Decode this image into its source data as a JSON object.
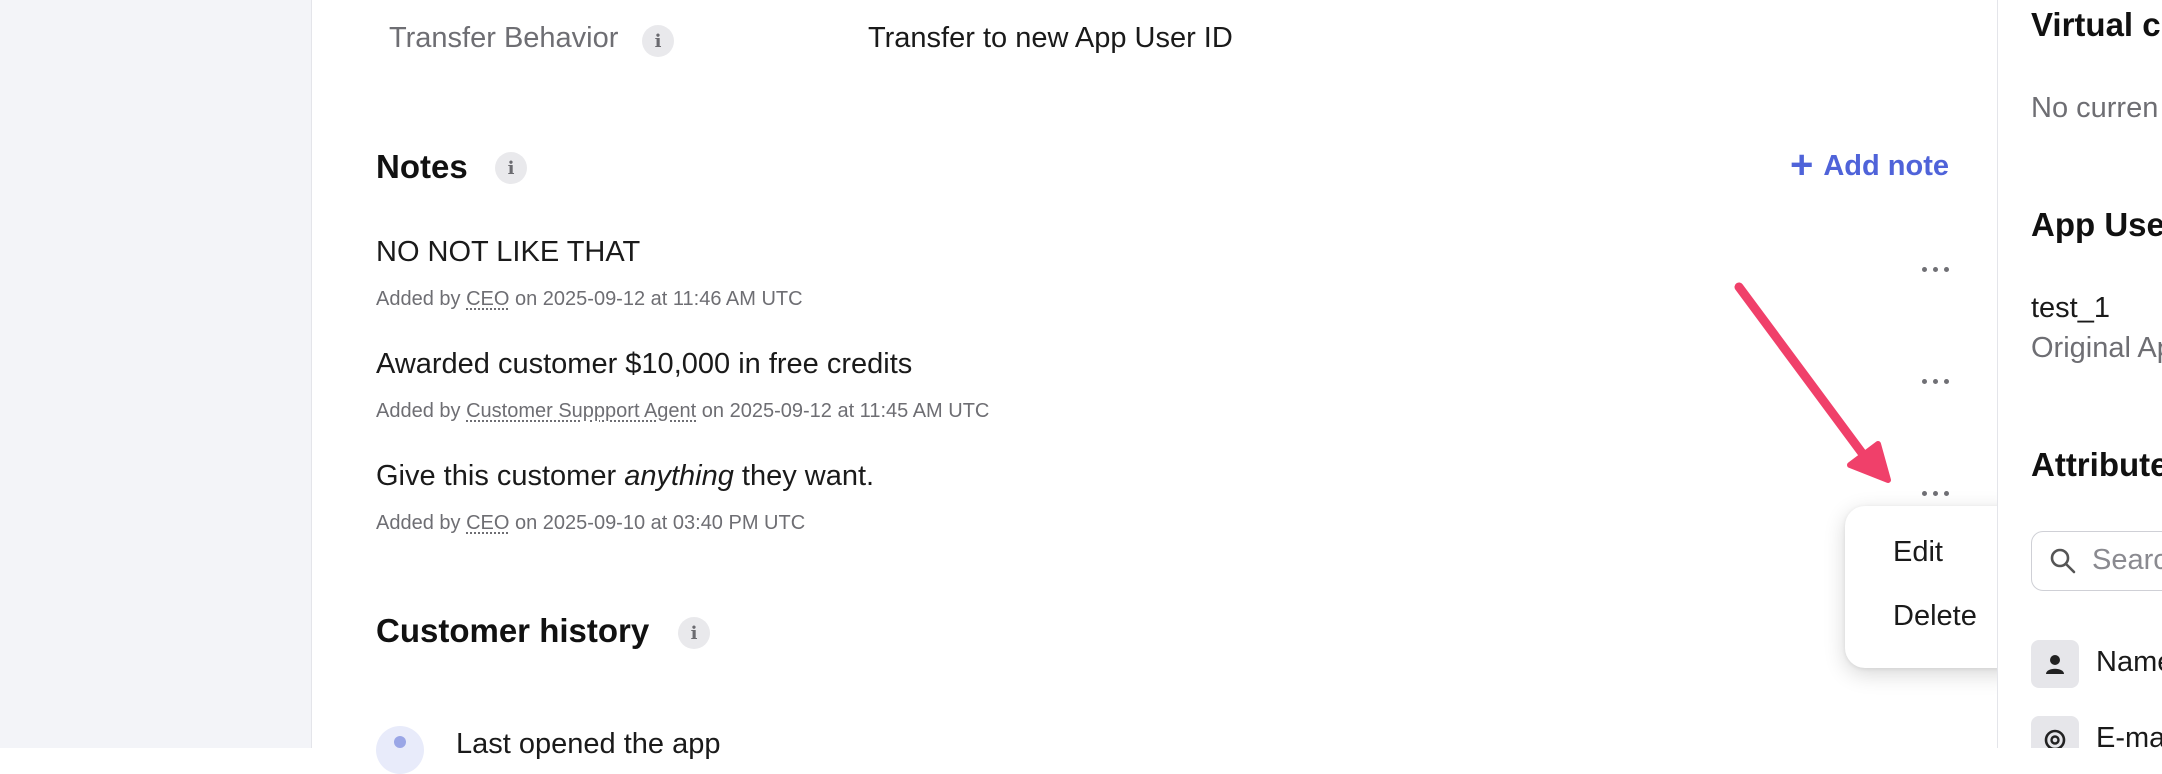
{
  "transfer": {
    "label": "Transfer Behavior",
    "value": "Transfer to new App User ID"
  },
  "notes": {
    "title": "Notes",
    "add_label": "Add note",
    "items": [
      {
        "text": "NO NOT LIKE THAT",
        "meta_prefix": "Added by",
        "author": "CEO",
        "meta_suffix": "on 2025-09-12 at 11:46 AM UTC"
      },
      {
        "text": "Awarded customer $10,000 in free credits",
        "meta_prefix": "Added by",
        "author": "Customer Suppport Agent",
        "meta_suffix": "on 2025-09-12 at 11:45 AM UTC"
      },
      {
        "text_before": "Give this customer",
        "text_emph": "anything",
        "text_after": "they want.",
        "meta_prefix": "Added by",
        "author": "CEO",
        "meta_suffix": "on 2025-09-10 at 03:40 PM UTC"
      }
    ]
  },
  "context_menu": {
    "edit": "Edit",
    "delete": "Delete"
  },
  "history": {
    "title": "Customer history",
    "first_item": "Last opened the app"
  },
  "right_panel": {
    "virtual_title": "Virtual c",
    "virtual_text": "No curren",
    "app_user_title": "App Use",
    "app_user_id": "test_1",
    "app_user_sub": "Original Ap",
    "attributes_title": "Attribute",
    "search_placeholder": "Searc",
    "attr_name": "Name",
    "attr_email": "E-ma"
  },
  "colors": {
    "accent": "#4f63d9",
    "arrow": "#f0406a",
    "gutter": "#f3f4f8"
  }
}
